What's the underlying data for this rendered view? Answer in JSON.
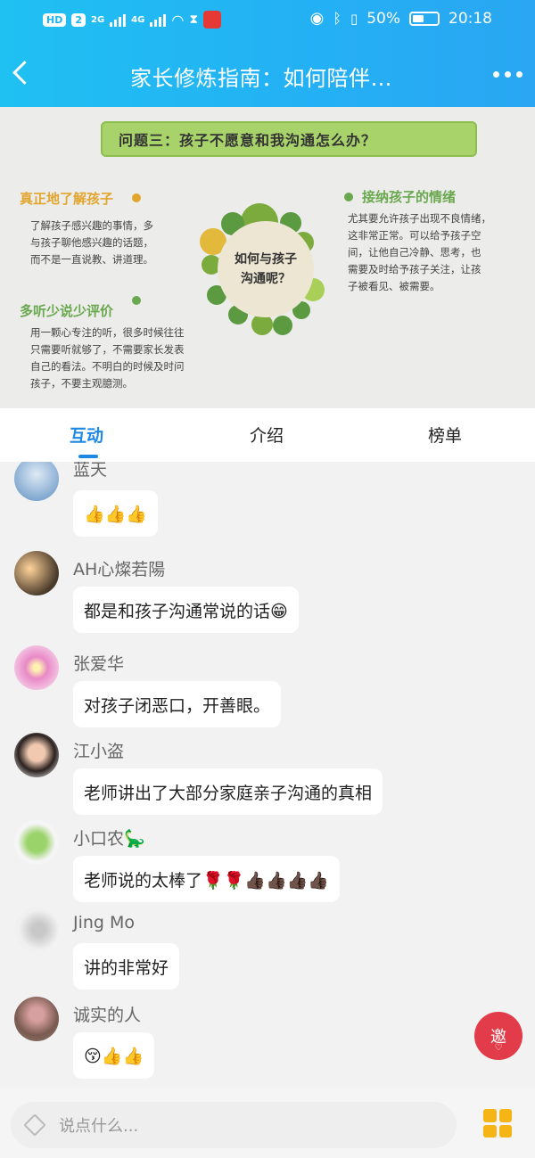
{
  "status": {
    "hd": "HD",
    "sim_slot": "2",
    "net_1": "2G",
    "net_2": "4G",
    "battery": "50%",
    "time": "20:18"
  },
  "header": {
    "title": "家长修炼指南：如何陪伴…"
  },
  "infographic": {
    "question": "问题三：孩子不愿意和我沟通怎么办？",
    "center": "如何与孩子\n沟通呢？",
    "sections": [
      {
        "title": "真正地了解孩子",
        "text": "了解孩子感兴趣的事情，多\n与孩子聊他感兴趣的话题，\n而不是一直说教、讲道理。",
        "color": "#e2a52d"
      },
      {
        "title": "多听少说少评价",
        "text": "用一颗心专注的听，很多时候往往\n只需要听就够了，不需要家长发表\n自己的看法。不明白的时候及时问\n孩子，不要主观臆测。",
        "color": "#6aa84f"
      },
      {
        "title": "接纳孩子的情绪",
        "text": "尤其要允许孩子出现不良情绪，\n这非常正常。可以给予孩子空\n间，让他自己冷静、思考，也\n需要及时给予孩子关注，让孩\n子被看见、被需要。",
        "color": "#6aa84f"
      }
    ]
  },
  "tabs": [
    "互动",
    "介绍",
    "榜单"
  ],
  "messages": [
    {
      "name": "蓝天",
      "text": "👍👍👍"
    },
    {
      "name": "AH心燦若陽",
      "text": "都是和孩子沟通常说的话😁"
    },
    {
      "name": "张爱华",
      "text": "对孩子闭恶口，开善眼。"
    },
    {
      "name": "江小盗",
      "text": "老师讲出了大部分家庭亲子沟通的真相"
    },
    {
      "name": "小口农🦕",
      "text": "老师说的太棒了🌹🌹👍🏿👍🏿👍🏿👍🏿"
    },
    {
      "name": "Jing Mo",
      "text": "讲的非常好"
    },
    {
      "name": "诚实的人",
      "text": "😚👍👍"
    }
  ],
  "invite": {
    "label": "邀"
  },
  "input": {
    "placeholder": "说点什么..."
  },
  "colors": {
    "brand": "#1e88e5",
    "header": "#24b0f4",
    "banner": "#a8d36b",
    "invite": "#e23c4a"
  }
}
